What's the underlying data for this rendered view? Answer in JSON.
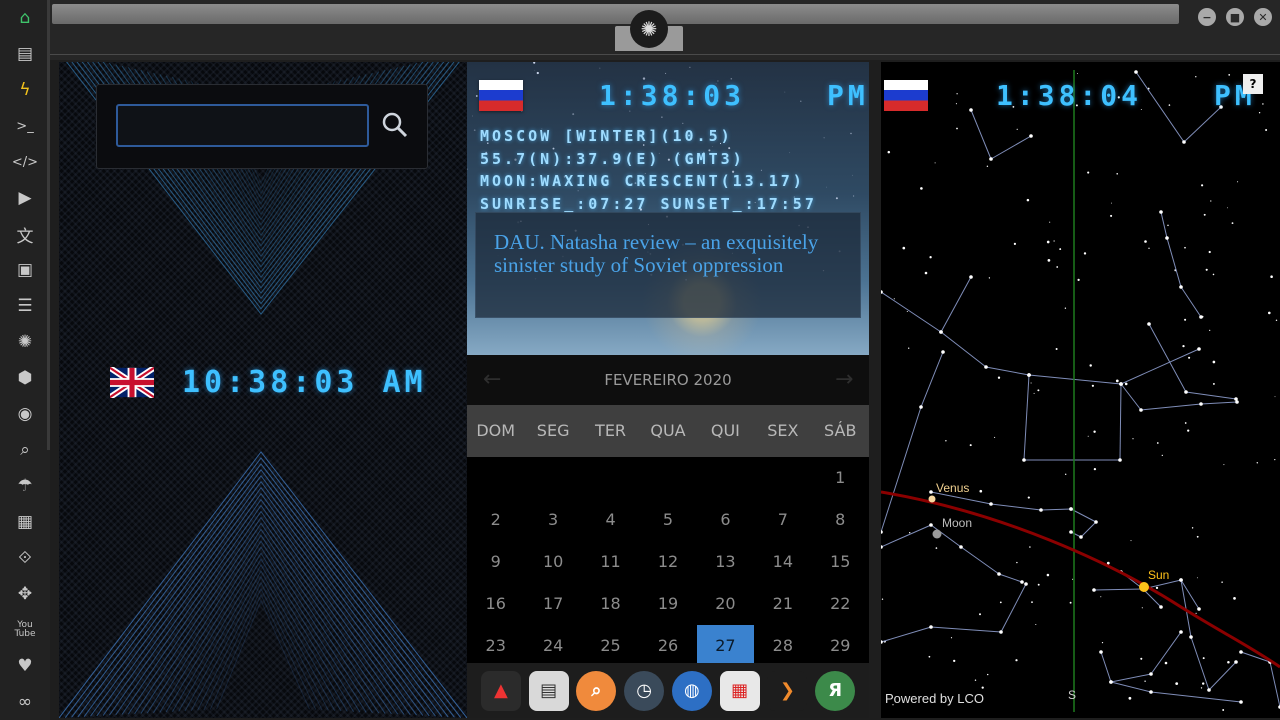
{
  "sidebar": {
    "items": [
      {
        "name": "home-icon",
        "glyph": "⌂",
        "color": "#3fc46b"
      },
      {
        "name": "document-icon",
        "glyph": "▤",
        "color": "#c8c8c8"
      },
      {
        "name": "lightning-icon",
        "glyph": "ϟ",
        "color": "#f2c21c"
      },
      {
        "name": "terminal-icon",
        "glyph": ">_",
        "color": "#c8c8c8"
      },
      {
        "name": "code-icon",
        "glyph": "</>",
        "color": "#c8c8c8"
      },
      {
        "name": "play-icon",
        "glyph": "▶",
        "color": "#c8c8c8"
      },
      {
        "name": "translate-icon",
        "glyph": "文",
        "color": "#c8c8c8"
      },
      {
        "name": "image-icon",
        "glyph": "▣",
        "color": "#c8c8c8"
      },
      {
        "name": "newspaper-icon",
        "glyph": "☰",
        "color": "#c8c8c8"
      },
      {
        "name": "rebel-icon",
        "glyph": "✺",
        "color": "#c8c8c8"
      },
      {
        "name": "cube-icon",
        "glyph": "⬢",
        "color": "#c8c8c8"
      },
      {
        "name": "globe-icon",
        "glyph": "◉",
        "color": "#c8c8c8"
      },
      {
        "name": "search-icon",
        "glyph": "⌕",
        "color": "#c8c8c8"
      },
      {
        "name": "umbrella-icon",
        "glyph": "☂",
        "color": "#c8c8c8"
      },
      {
        "name": "contact-icon",
        "glyph": "▦",
        "color": "#c8c8c8"
      },
      {
        "name": "link-icon",
        "glyph": "⟐",
        "color": "#c8c8c8"
      },
      {
        "name": "expand-icon",
        "glyph": "✥",
        "color": "#c8c8c8"
      },
      {
        "name": "youtube-icon",
        "glyph": "You\nTube",
        "color": "#c8c8c8"
      },
      {
        "name": "heart-icon",
        "glyph": "♥",
        "color": "#c8c8c8"
      },
      {
        "name": "infinity-icon",
        "glyph": "∞",
        "color": "#c8c8c8"
      }
    ]
  },
  "window": {
    "controls": [
      "−",
      "■",
      "✕"
    ]
  },
  "left": {
    "clock": {
      "time": "10:38:03",
      "ampm": "AM",
      "flag": "uk-flag"
    }
  },
  "middle": {
    "clock": {
      "time": "1:38:03",
      "ampm": "PM",
      "flag": "russia-flag"
    },
    "info_lines": [
      "MOSCOW [WINTER](10.5)",
      "55.7(N):37.9(E) (GMT3)",
      "MOON:WAXING CRESCENT(13.17)",
      "SUNRISE_:07:27 SUNSET_:17:57"
    ],
    "news_title": "DAU. Natasha review – an exquisitely sinister study of Soviet oppression",
    "calendar": {
      "month_label": "FEVEREIRO 2020",
      "weekdays": [
        "DOM",
        "SEG",
        "TER",
        "QUA",
        "QUI",
        "SEX",
        "SÁB"
      ],
      "first_weekday_index": 6,
      "days_shown": 29,
      "today": 27
    },
    "dock": [
      {
        "name": "app-red-icon",
        "glyph": "▲",
        "bg": "#2b2b2b",
        "fg": "#e33"
      },
      {
        "name": "news-app-icon",
        "glyph": "▤",
        "bg": "#d9d9d9",
        "fg": "#333"
      },
      {
        "name": "search-app-icon",
        "glyph": "⌕",
        "bg": "#f08a3c",
        "fg": "#fff"
      },
      {
        "name": "clock-app-icon",
        "glyph": "◷",
        "bg": "#3a4a5a",
        "fg": "#fff"
      },
      {
        "name": "browser-app-icon",
        "glyph": "◍",
        "bg": "#2d6fc4",
        "fg": "#fff"
      },
      {
        "name": "calendar-app-icon",
        "glyph": "▦",
        "bg": "#e8e8e8",
        "fg": "#d22"
      },
      {
        "name": "arrow-app-icon",
        "glyph": "❯",
        "bg": "#1d1d1d",
        "fg": "#f08a2c"
      },
      {
        "name": "yandex-app-icon",
        "glyph": "Я",
        "bg": "#3c8a4a",
        "fg": "#fff"
      }
    ]
  },
  "right": {
    "clock": {
      "time": "1:38:04",
      "ampm": "PM",
      "flag": "russia-flag"
    },
    "labels": {
      "venus": "Venus",
      "moon": "Moon",
      "sun": "Sun",
      "south": "S"
    },
    "powered_by": "Powered by LCO",
    "help": "?"
  },
  "colors": {
    "digit": "#3ec0ff",
    "accent": "#3a82cf",
    "ecliptic": "#8b0000",
    "meridian": "#1e7a1e"
  }
}
